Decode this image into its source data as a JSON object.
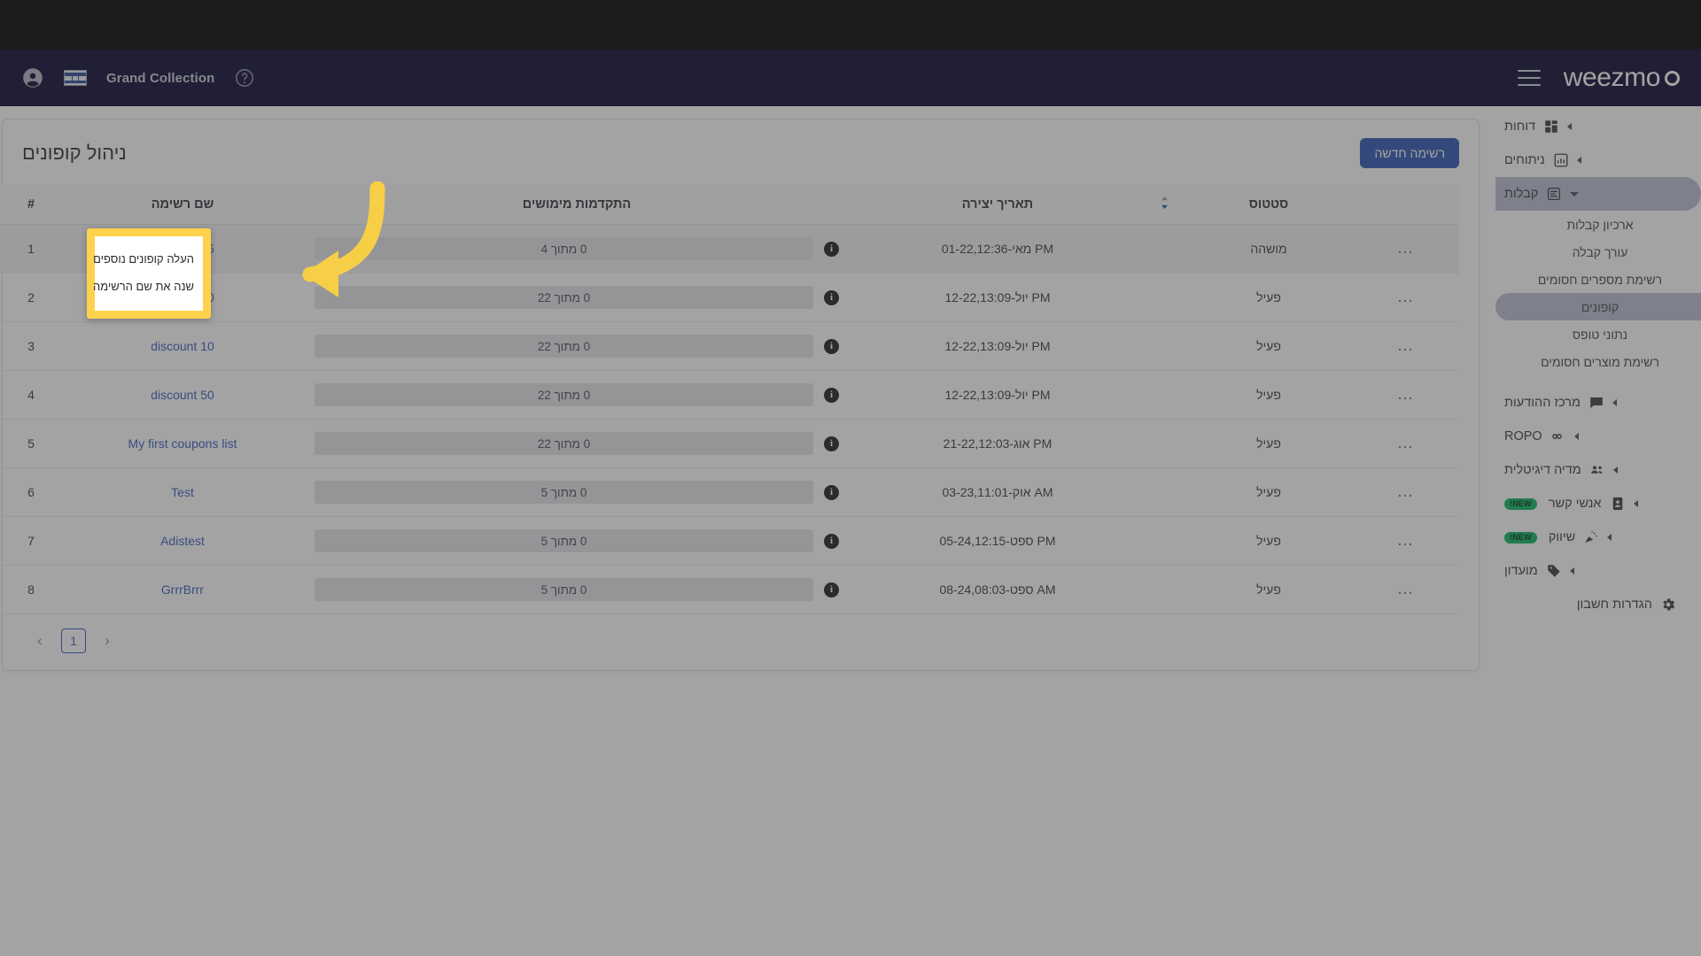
{
  "topbar": {
    "account_name": "Grand Collection",
    "brand": "weezmo",
    "avatar_icon": "account-circle-icon",
    "flag_icon": "israel-flag-icon",
    "help_icon": "help-circle-icon",
    "menu_icon": "hamburger-menu-icon"
  },
  "sidebar": {
    "items": [
      {
        "label": "דוחות",
        "icon": "dashboard-grid-icon",
        "expandable": true,
        "selected": false
      },
      {
        "label": "ניתוחים",
        "icon": "bar-chart-icon",
        "expandable": true,
        "selected": false
      },
      {
        "label": "קבלות",
        "icon": "receipt-icon",
        "expandable": true,
        "expanded": true,
        "selected": true
      }
    ],
    "receipts_subitems": [
      {
        "label": "ארכיון קבלות",
        "selected": false
      },
      {
        "label": "עורך קבלה",
        "selected": false
      },
      {
        "label": "רשימת מספרים חסומים",
        "selected": false
      },
      {
        "label": "קופונים",
        "selected": true
      },
      {
        "label": "נתוני טופס",
        "selected": false
      },
      {
        "label": "רשימת מוצרים חסומים",
        "selected": false
      }
    ],
    "items_bottom": [
      {
        "label": "מרכז ההודעות",
        "icon": "chat-bubble-icon",
        "expandable": true,
        "badge": ""
      },
      {
        "label": "ROPO",
        "icon": "infinity-icon",
        "expandable": true,
        "badge": ""
      },
      {
        "label": "מדיה דיגיטלית",
        "icon": "people-group-icon",
        "expandable": true,
        "badge": ""
      },
      {
        "label": "אנשי קשר",
        "icon": "contact-card-icon",
        "expandable": true,
        "badge": "NEW!"
      },
      {
        "label": "שיווק",
        "icon": "megaphone-icon",
        "expandable": true,
        "badge": "NEW!"
      },
      {
        "label": "מועדון",
        "icon": "tag-icon",
        "expandable": true,
        "badge": ""
      },
      {
        "label": "הגדרות חשבון",
        "icon": "gear-icon",
        "expandable": false,
        "badge": ""
      }
    ],
    "badge_new_color": "#0bb661",
    "selected_bg": "#b9bfd2"
  },
  "main": {
    "page_title": "ניהול קופונים",
    "new_list_button": "רשימה חדשה",
    "table": {
      "headers": {
        "num": "#",
        "list_name": "שם רשימה",
        "redemptions": "התקדמות מימושים",
        "created": "תאריך יצירה",
        "sort": "sort-icon",
        "status": "סטטוס",
        "menu": ""
      },
      "rows": [
        {
          "num": "1",
          "name": "discount 15",
          "progress": "0 מתוך 4",
          "created": "01-מאי-22,12:36 PM",
          "status": "מושהה",
          "menu": "…"
        },
        {
          "num": "2",
          "name": "discount 20",
          "progress": "0 מתוך 22",
          "created": "12-יול-22,13:09 PM",
          "status": "פעיל",
          "menu": "…"
        },
        {
          "num": "3",
          "name": "discount 10",
          "progress": "0 מתוך 22",
          "created": "12-יול-22,13:09 PM",
          "status": "פעיל",
          "menu": "…"
        },
        {
          "num": "4",
          "name": "discount 50",
          "progress": "0 מתוך 22",
          "created": "12-יול-22,13:09 PM",
          "status": "פעיל",
          "menu": "…"
        },
        {
          "num": "5",
          "name": "My first coupons list",
          "progress": "0 מתוך 22",
          "created": "21-אוג-22,12:03 PM",
          "status": "פעיל",
          "menu": "…"
        },
        {
          "num": "6",
          "name": "Test",
          "progress": "0 מתוך 5",
          "created": "03-אוק-23,11:01 AM",
          "status": "פעיל",
          "menu": "…"
        },
        {
          "num": "7",
          "name": "Adistest",
          "progress": "0 מתוך 5",
          "created": "05-ספט-24,12:15 PM",
          "status": "פעיל",
          "menu": "…"
        },
        {
          "num": "8",
          "name": "GrrrBrrr",
          "progress": "0 מתוך 5",
          "created": "08-ספט-24,08:03 AM",
          "status": "פעיל",
          "menu": "…"
        }
      ]
    },
    "pagination": {
      "prev": "‹",
      "current_page": "1",
      "next": "›"
    }
  },
  "context_menu": {
    "items": [
      {
        "label": "העלה קופונים נוספים"
      },
      {
        "label": "שנה את שם הרשימה"
      }
    ],
    "highlight_color": "#ffd24d"
  },
  "annotation": {
    "arrow_color": "#f7cf46",
    "arrow_direction": "curved-left-pointing"
  },
  "colors": {
    "topbar_bg": "#0a0630",
    "primary_button": "#2f55b3",
    "link": "#3a5bbf",
    "overlay": "rgba(60,60,60,0.47)"
  }
}
